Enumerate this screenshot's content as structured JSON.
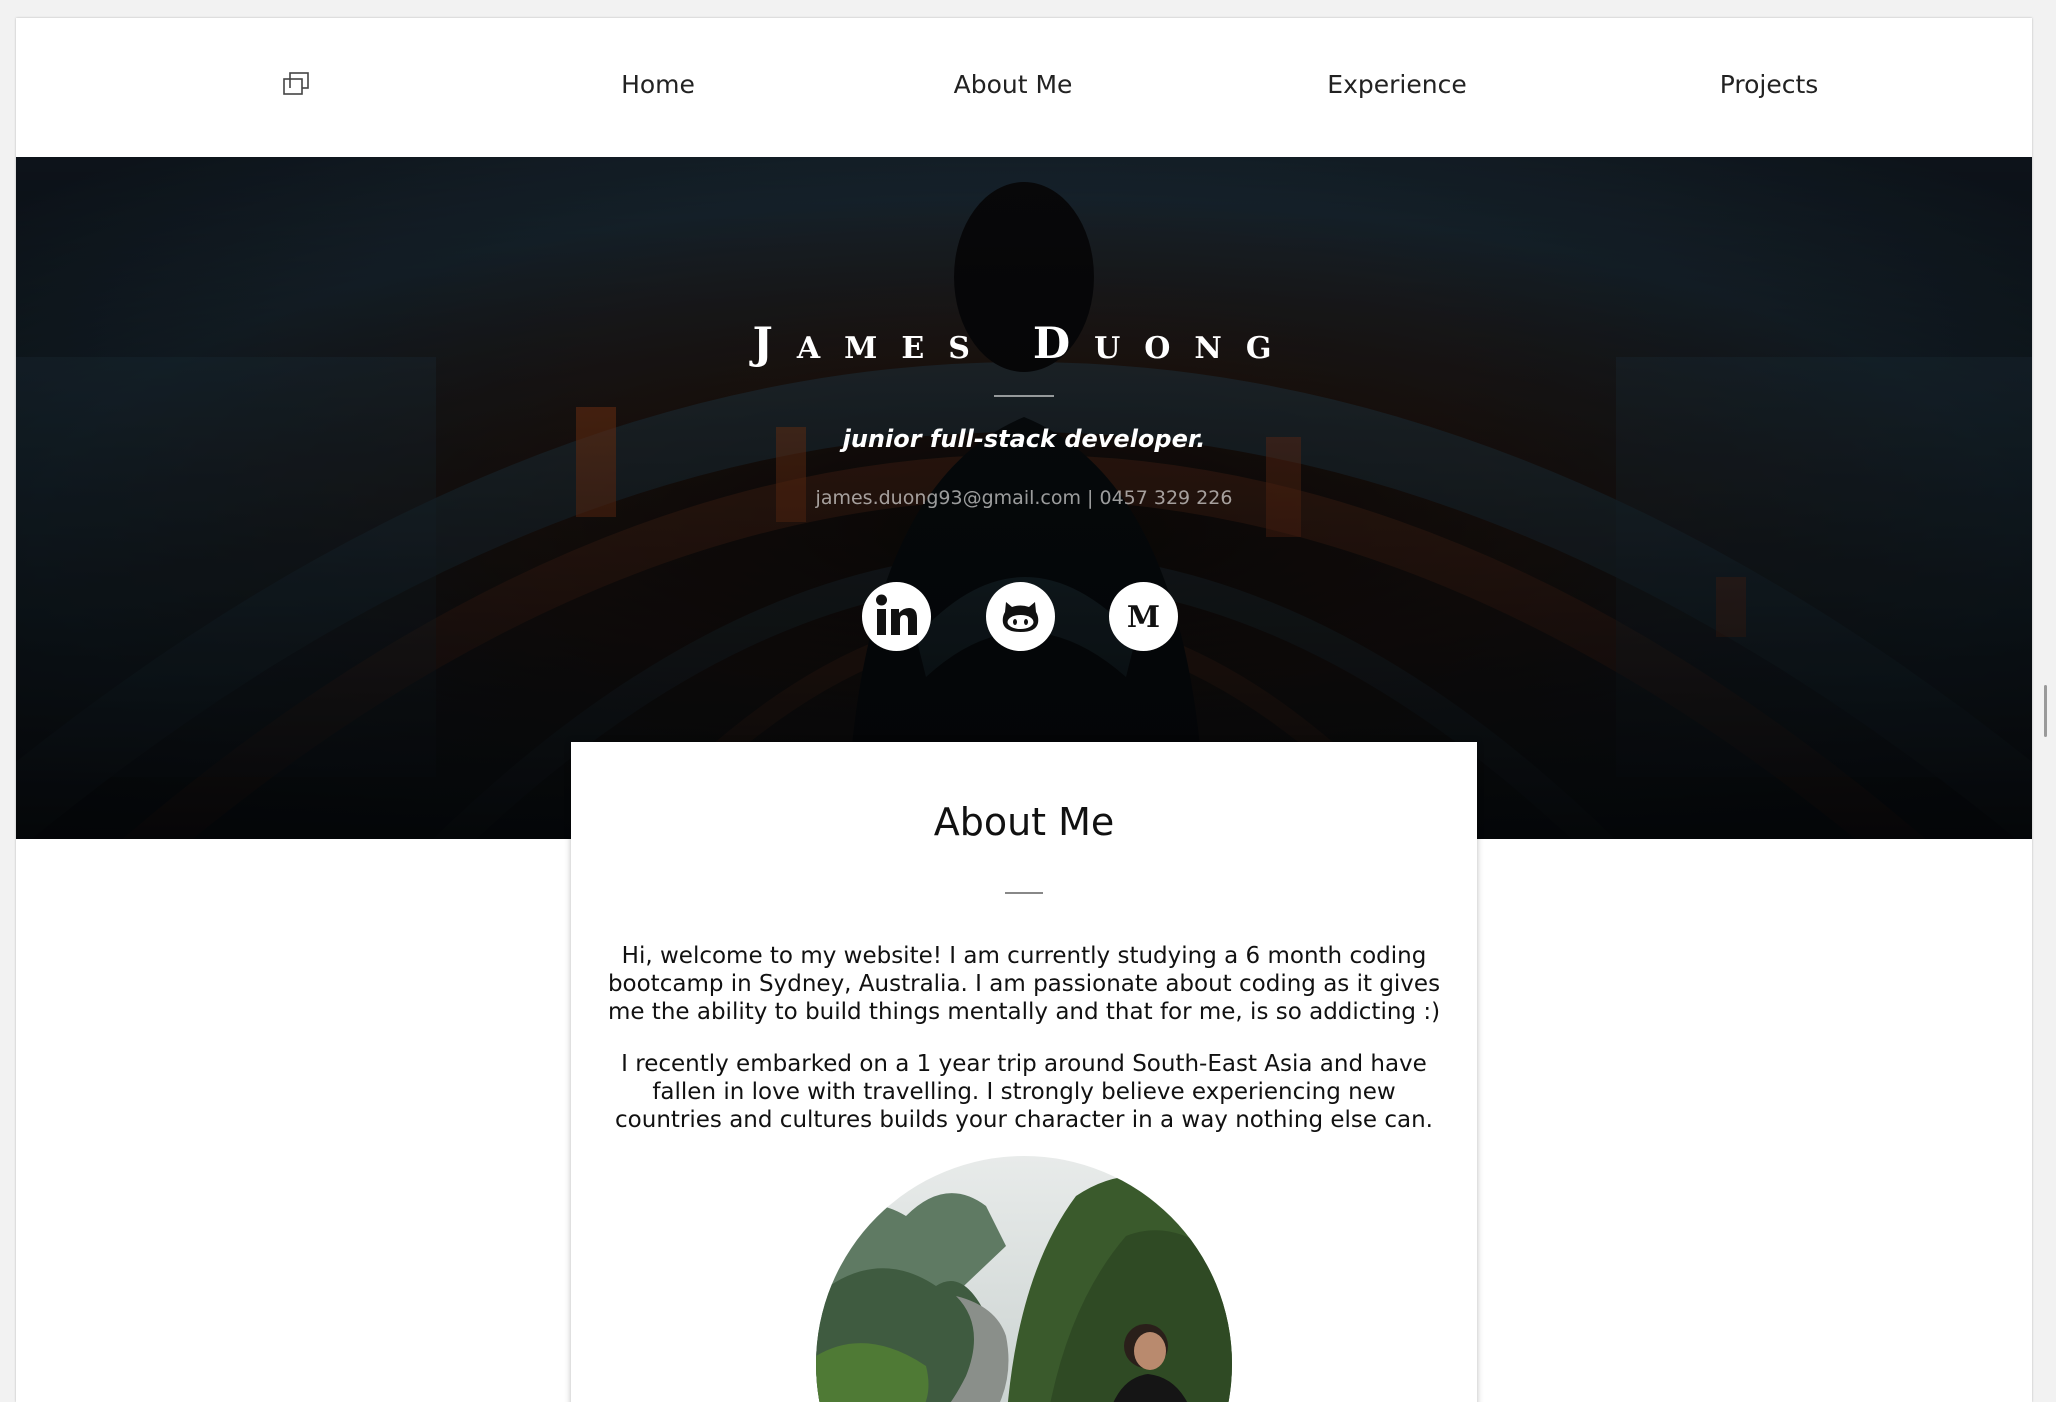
{
  "nav": {
    "items": [
      {
        "label": "Home"
      },
      {
        "label": "About Me"
      },
      {
        "label": "Experience"
      },
      {
        "label": "Projects"
      }
    ]
  },
  "hero": {
    "name": "James Duong",
    "tagline": "junior full-stack developer.",
    "contact": "james.duong93@gmail.com | 0457 329 226",
    "social": [
      "linkedin-icon",
      "github-icon",
      "medium-icon"
    ]
  },
  "about": {
    "title": "About Me",
    "paragraphs": [
      "Hi, welcome to my website! I am currently studying a 6 month coding bootcamp in Sydney, Australia. I am passionate about coding as it gives me the ability to build things mentally and that for me, is so addicting :)",
      "I recently embarked on a 1 year trip around South-East Asia and have fallen in love with travelling. I strongly believe experiencing new countries and cultures builds your character in a way nothing else can."
    ]
  }
}
